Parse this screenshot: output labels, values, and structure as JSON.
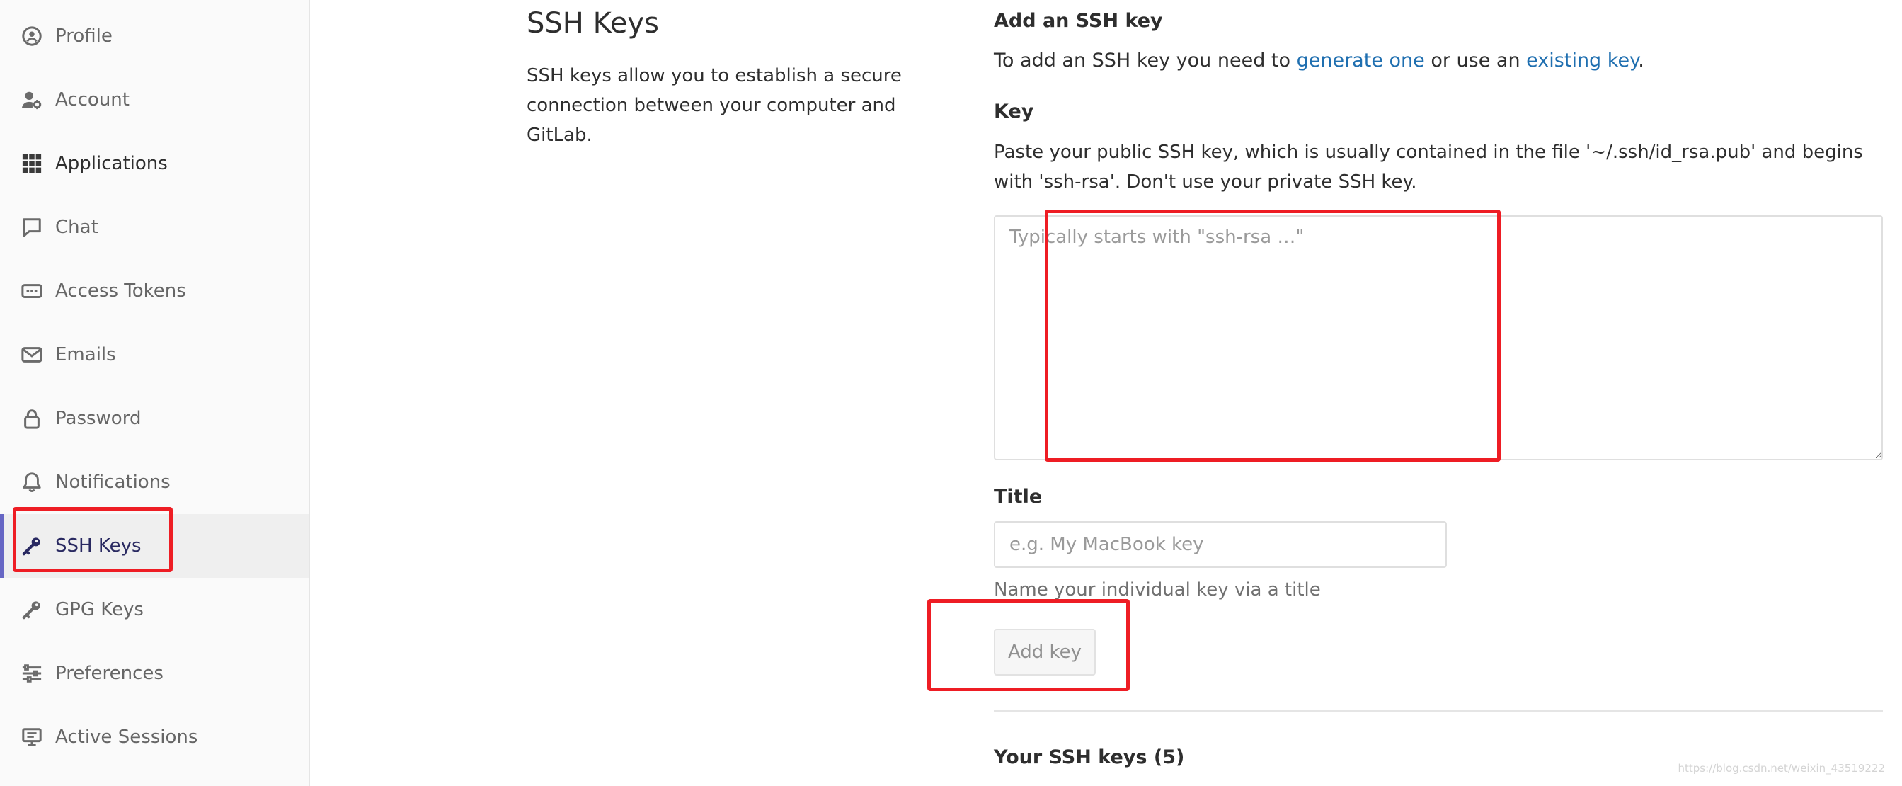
{
  "sidebar": {
    "items": [
      {
        "label": "Profile",
        "icon": "profile-icon"
      },
      {
        "label": "Account",
        "icon": "account-icon"
      },
      {
        "label": "Applications",
        "icon": "applications-icon"
      },
      {
        "label": "Chat",
        "icon": "chat-icon"
      },
      {
        "label": "Access Tokens",
        "icon": "access-tokens-icon"
      },
      {
        "label": "Emails",
        "icon": "emails-icon"
      },
      {
        "label": "Password",
        "icon": "password-icon"
      },
      {
        "label": "Notifications",
        "icon": "notifications-icon"
      },
      {
        "label": "SSH Keys",
        "icon": "ssh-key-icon",
        "active": true
      },
      {
        "label": "GPG Keys",
        "icon": "gpg-key-icon"
      },
      {
        "label": "Preferences",
        "icon": "preferences-icon"
      },
      {
        "label": "Active Sessions",
        "icon": "active-sessions-icon"
      }
    ]
  },
  "settings": {
    "title": "SSH Keys",
    "description": "SSH keys allow you to establish a secure connection between your computer and GitLab."
  },
  "form": {
    "heading": "Add an SSH key",
    "intro_prefix": "To add an SSH key you need to ",
    "generate_link": "generate one",
    "intro_middle": " or use an ",
    "existing_link": "existing key",
    "intro_suffix": ".",
    "key_label": "Key",
    "key_help": "Paste your public SSH key, which is usually contained in the file '~/.ssh/id_rsa.pub' and begins with 'ssh-rsa'. Don't use your private SSH key.",
    "key_placeholder": "Typically starts with \"ssh-rsa …\"",
    "key_value": "",
    "title_label": "Title",
    "title_placeholder": "e.g. My MacBook key",
    "title_value": "",
    "title_help": "Name your individual key via a title",
    "submit_label": "Add key"
  },
  "keys_list": {
    "heading": "Your SSH keys (5)"
  },
  "watermark": "https://blog.csdn.net/weixin_43519222",
  "colors": {
    "accent": "#6666c4",
    "active_text": "#292961",
    "link": "#1f6fb0",
    "annotation": "#ee1d24"
  }
}
